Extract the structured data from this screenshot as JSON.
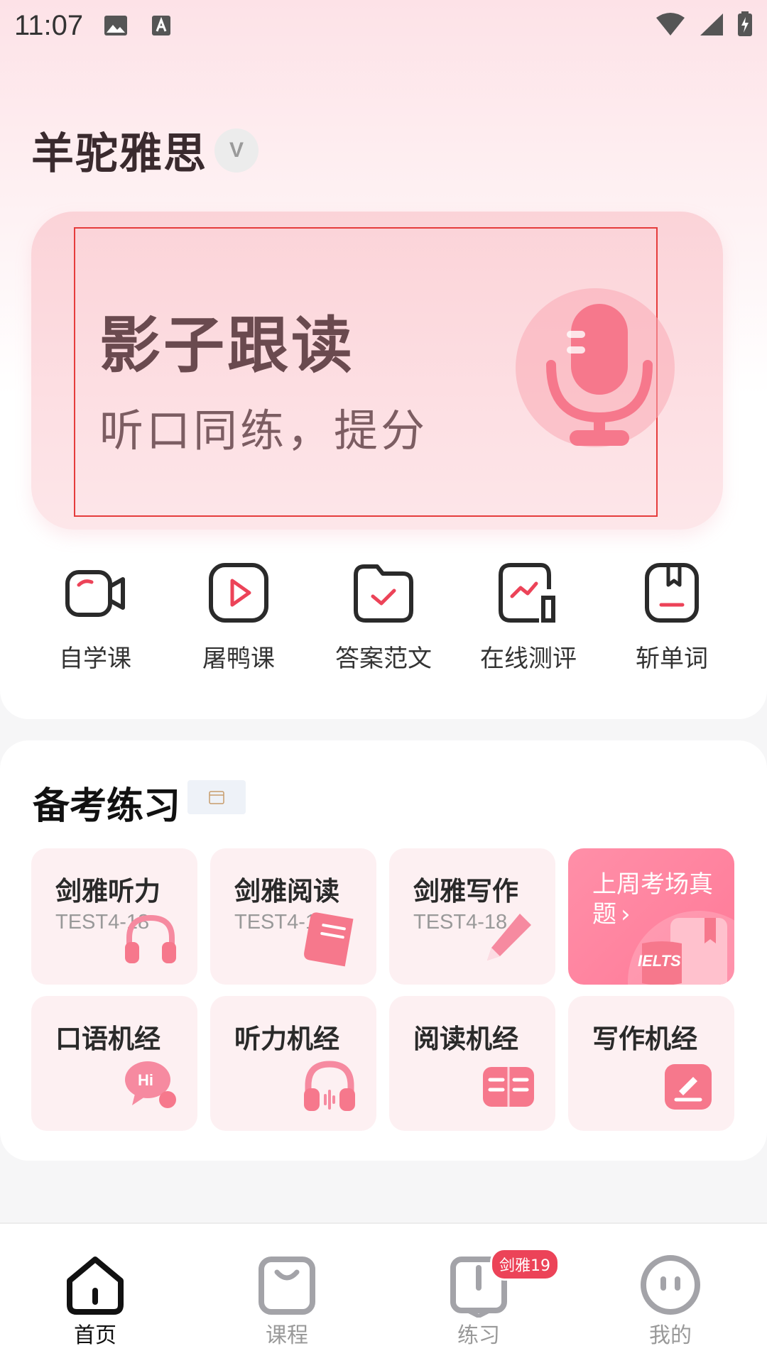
{
  "status_bar": {
    "time": "11:07"
  },
  "brand": {
    "title": "羊驼雅思",
    "badge": "V"
  },
  "banner": {
    "title": "影子跟读",
    "subtitle": "听口同练，提分"
  },
  "quick_actions": [
    {
      "label": "自学课",
      "icon": "camera-play-icon"
    },
    {
      "label": "屠鸭课",
      "icon": "play-square-icon"
    },
    {
      "label": "答案范文",
      "icon": "folder-check-icon"
    },
    {
      "label": "在线测评",
      "icon": "chart-assessment-icon"
    },
    {
      "label": "斩单词",
      "icon": "bookmark-book-icon"
    }
  ],
  "practice": {
    "title": "备考练习",
    "tiles": [
      {
        "title": "剑雅听力",
        "sub": "TEST4-18",
        "icon": "headphones-icon"
      },
      {
        "title": "剑雅阅读",
        "sub": "TEST4-18",
        "icon": "book-icon"
      },
      {
        "title": "剑雅写作",
        "sub": "TEST4-18",
        "icon": "pen-icon"
      },
      {
        "title": "上周考场真题",
        "arrow": "›",
        "badge_text": "IELTS",
        "icon": "ielts-book-icon"
      },
      {
        "title": "口语机经",
        "icon": "hi-chat-icon"
      },
      {
        "title": "听力机经",
        "icon": "headphones-icon"
      },
      {
        "title": "阅读机经",
        "icon": "open-book-icon"
      },
      {
        "title": "写作机经",
        "icon": "edit-icon"
      }
    ]
  },
  "tabbar": {
    "tabs": [
      {
        "label": "首页",
        "active": true
      },
      {
        "label": "课程",
        "active": false
      },
      {
        "label": "练习",
        "active": false,
        "badge": "剑雅19"
      },
      {
        "label": "我的",
        "active": false
      }
    ]
  },
  "colors": {
    "accent": "#ff7a98",
    "badge": "#ec4358",
    "banner_frame": "#e53c3c"
  }
}
